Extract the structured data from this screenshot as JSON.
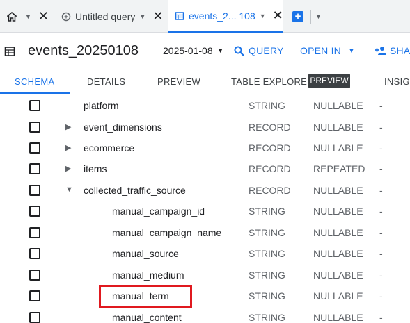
{
  "tabs": {
    "home": {
      "icon": "home-icon"
    },
    "query": {
      "label": "Untitled query",
      "icon": "query-icon"
    },
    "events": {
      "label": "events_2... 108",
      "icon": "table-icon"
    },
    "add": {
      "icon": "add-tab-icon"
    }
  },
  "header": {
    "title": "events_20250108",
    "date": "2025-01-08",
    "query_label": "QUERY",
    "openin_label": "OPEN IN",
    "share_label": "SHA"
  },
  "subtabs": [
    "SCHEMA",
    "DETAILS",
    "PREVIEW",
    "TABLE EXPLORER",
    "INSIG"
  ],
  "preview_badge": "PREVIEW",
  "rows": [
    {
      "name": "platform",
      "type": "STRING",
      "mode": "NULLABLE",
      "desc": "-"
    },
    {
      "name": "event_dimensions",
      "type": "RECORD",
      "mode": "NULLABLE",
      "desc": "-"
    },
    {
      "name": "ecommerce",
      "type": "RECORD",
      "mode": "NULLABLE",
      "desc": "-"
    },
    {
      "name": "items",
      "type": "RECORD",
      "mode": "REPEATED",
      "desc": "-"
    },
    {
      "name": "collected_traffic_source",
      "type": "RECORD",
      "mode": "NULLABLE",
      "desc": "-"
    },
    {
      "name": "manual_campaign_id",
      "type": "STRING",
      "mode": "NULLABLE",
      "desc": "-"
    },
    {
      "name": "manual_campaign_name",
      "type": "STRING",
      "mode": "NULLABLE",
      "desc": "-"
    },
    {
      "name": "manual_source",
      "type": "STRING",
      "mode": "NULLABLE",
      "desc": "-"
    },
    {
      "name": "manual_medium",
      "type": "STRING",
      "mode": "NULLABLE",
      "desc": "-"
    },
    {
      "name": "manual_term",
      "type": "STRING",
      "mode": "NULLABLE",
      "desc": "-"
    },
    {
      "name": "manual_content",
      "type": "STRING",
      "mode": "NULLABLE",
      "desc": "-"
    }
  ],
  "colors": {
    "accent": "#1a73e8",
    "highlight": "#e0191f"
  }
}
